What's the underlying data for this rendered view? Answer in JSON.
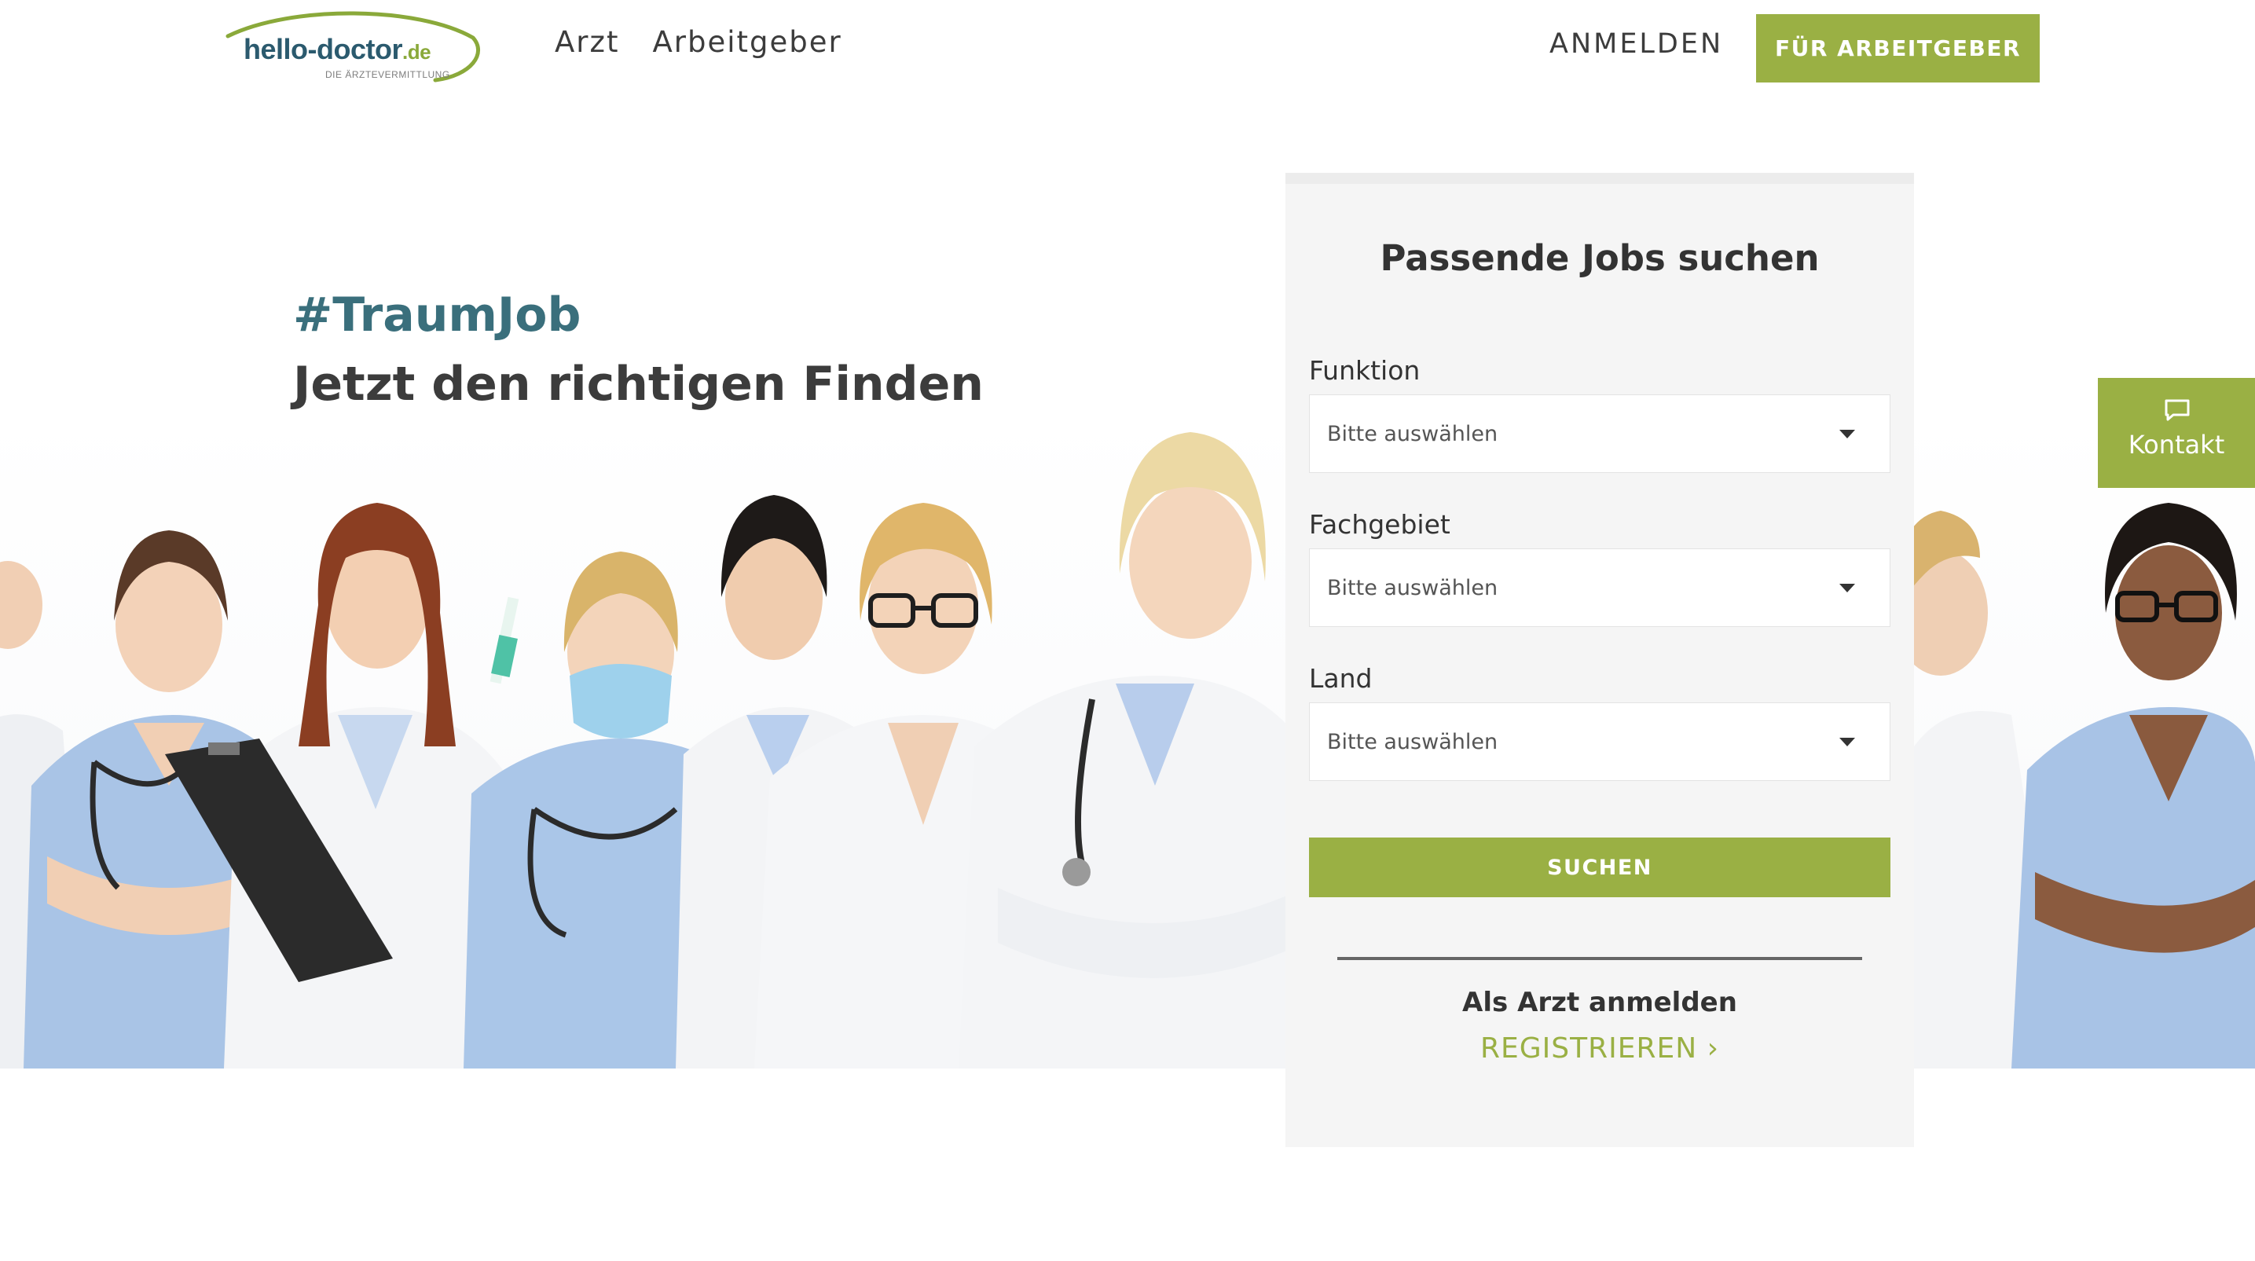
{
  "brand": {
    "logo_name": "hello-doctor",
    "logo_tld": ".de",
    "tagline": "DIE ÄRZTEVERMITTLUNG"
  },
  "nav": {
    "items": [
      {
        "label": "Arzt"
      },
      {
        "label": "Arbeitgeber"
      }
    ],
    "login_label": "ANMELDEN",
    "employer_button": "FÜR ARBEITGEBER"
  },
  "hero": {
    "hashtag": "#TraumJob",
    "subtitle": "Jetzt den richtigen Finden"
  },
  "search": {
    "title": "Passende Jobs suchen",
    "fields": [
      {
        "label": "Funktion",
        "placeholder": "Bitte auswählen"
      },
      {
        "label": "Fachgebiet",
        "placeholder": "Bitte auswählen"
      },
      {
        "label": "Land",
        "placeholder": "Bitte auswählen"
      }
    ],
    "submit_label": "SUCHEN",
    "register_heading": "Als Arzt anmelden",
    "register_link": "REGISTRIEREN ›"
  },
  "contact": {
    "label": "Kontakt",
    "icon": "chat-bubble-icon"
  },
  "colors": {
    "accent_green": "#9ab044",
    "teal_heading": "#3a6f7c",
    "logo_blue": "#2b5a6e"
  }
}
